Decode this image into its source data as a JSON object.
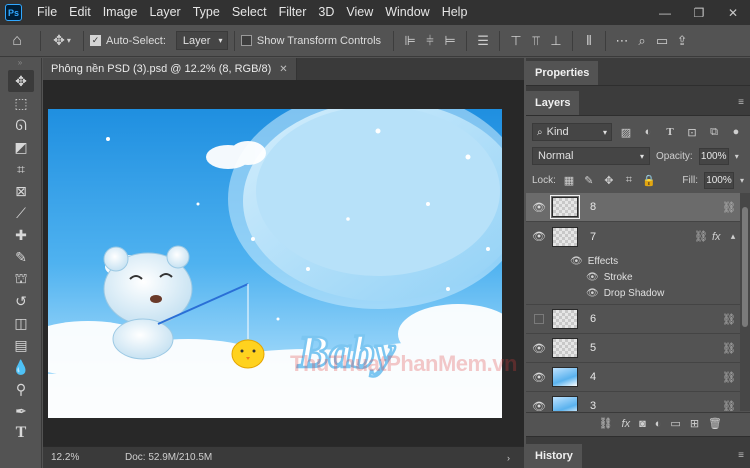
{
  "app": {
    "logo": "Ps"
  },
  "menu": [
    "File",
    "Edit",
    "Image",
    "Layer",
    "Type",
    "Select",
    "Filter",
    "3D",
    "View",
    "Window",
    "Help"
  ],
  "window_controls": {
    "minimize": "—",
    "restore": "❐",
    "close": "✕"
  },
  "options": {
    "auto_select_label": "Auto-Select:",
    "auto_select_checked": true,
    "auto_select_target": "Layer",
    "transform_controls_label": "Show Transform Controls",
    "transform_controls_checked": false
  },
  "document": {
    "tab_title": "Phông nền PSD (3).psd @ 12.2% (8, RGB/8)",
    "close": "✕",
    "canvas_text": "Baby"
  },
  "status": {
    "zoom": "12.2%",
    "doc": "Doc: 52.9M/210.5M"
  },
  "watermark": "ThuThuatPhanMem.vn",
  "panels": {
    "properties_tab": "Properties",
    "layers_tab": "Layers",
    "history_tab": "History",
    "kind_label": "Kind",
    "blend_mode": "Normal",
    "opacity_label": "Opacity:",
    "opacity_value": "100%",
    "lock_label": "Lock:",
    "fill_label": "Fill:",
    "fill_value": "100%"
  },
  "layers": [
    {
      "name": "8",
      "visible": true,
      "selected": true,
      "thumb": "transparent",
      "fx": false
    },
    {
      "name": "7",
      "visible": true,
      "selected": false,
      "thumb": "transparent",
      "fx": true,
      "effects_label": "Effects",
      "effects": [
        "Stroke",
        "Drop Shadow"
      ]
    },
    {
      "name": "6",
      "visible": false,
      "selected": false,
      "thumb": "transparent",
      "fx": false
    },
    {
      "name": "5",
      "visible": true,
      "selected": false,
      "thumb": "transparent",
      "fx": false
    },
    {
      "name": "4",
      "visible": true,
      "selected": false,
      "thumb": "photo",
      "fx": false
    },
    {
      "name": "3",
      "visible": true,
      "selected": false,
      "thumb": "photo",
      "fx": false
    }
  ],
  "colors": {
    "chrome_dark": "#323232",
    "panel": "#535353",
    "accent": "#31a8ff",
    "sky": "#5ab2ee"
  }
}
